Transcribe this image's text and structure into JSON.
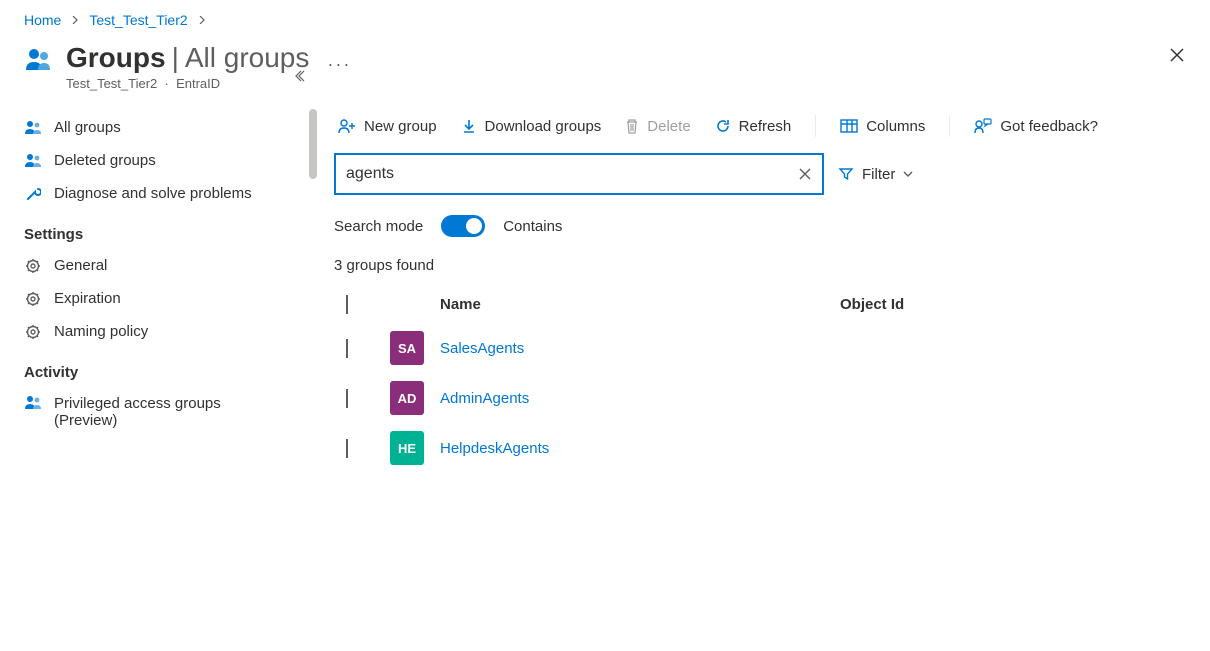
{
  "breadcrumb": {
    "home": "Home",
    "tenant": "Test_Test_Tier2"
  },
  "header": {
    "title": "Groups",
    "subtitle_sep": "|",
    "subtitle": "All groups",
    "tenant": "Test_Test_Tier2",
    "directory": "EntraID"
  },
  "nav": {
    "items": {
      "all_groups": "All groups",
      "deleted_groups": "Deleted groups",
      "diagnose": "Diagnose and solve problems"
    },
    "sections": {
      "settings": "Settings",
      "activity": "Activity"
    },
    "settings": {
      "general": "General",
      "expiration": "Expiration",
      "naming": "Naming policy"
    },
    "activity": {
      "pag": "Privileged access groups (Preview)"
    }
  },
  "toolbar": {
    "new_group": "New group",
    "download": "Download groups",
    "delete": "Delete",
    "refresh": "Refresh",
    "columns": "Columns",
    "feedback": "Got feedback?"
  },
  "search": {
    "value": "agents",
    "filter_label": "Filter",
    "mode_label": "Search mode",
    "mode_value": "Contains"
  },
  "results": {
    "count_text": "3 groups found",
    "columns": {
      "name": "Name",
      "object_id": "Object Id"
    },
    "rows": [
      {
        "initials": "SA",
        "name": "SalesAgents",
        "color": "#8a2d7a"
      },
      {
        "initials": "AD",
        "name": "AdminAgents",
        "color": "#8a2d7a"
      },
      {
        "initials": "HE",
        "name": "HelpdeskAgents",
        "color": "#00b294"
      }
    ]
  }
}
